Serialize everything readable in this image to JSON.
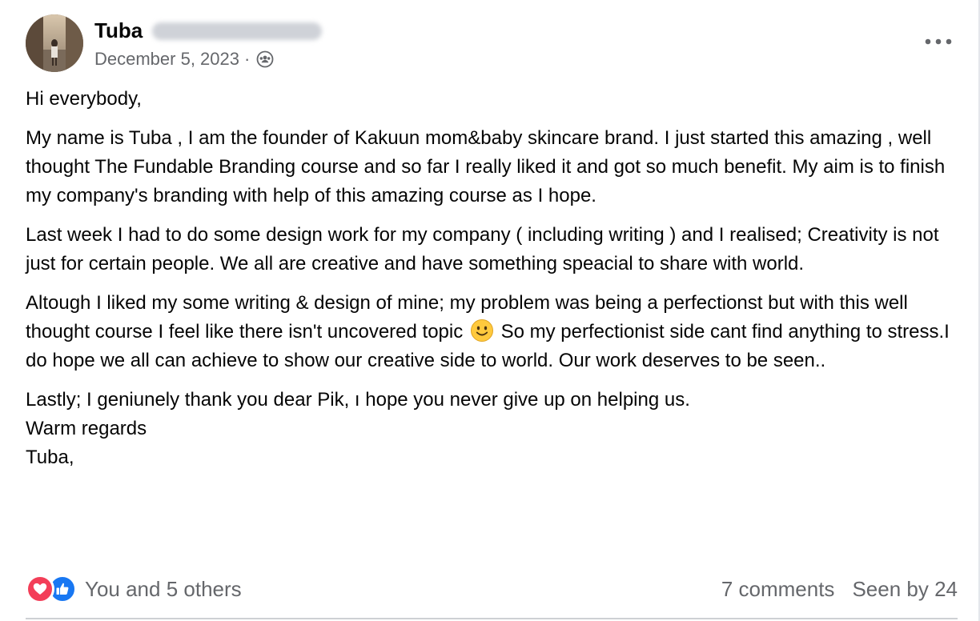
{
  "post": {
    "author_first_name": "Tuba",
    "date": "December 5, 2023",
    "separator": "·",
    "privacy_icon": "group-members-icon",
    "more_icon": "more-horizontal-icon",
    "paragraphs": [
      "Hi everybody,",
      "My name is Tuba , I am the founder of Kakuun mom&baby skincare brand. I just started this amazing , well thought The Fundable Branding course and so far I really liked it and got so much benefit. My aim is to finish my company's branding with help of this amazing course as I hope.",
      "Last week I had to do some design work for my company ( including writing ) and I realised; Creativity is not just for certain people. We all are creative and have something speacial to share with world."
    ],
    "paragraph4_before_emoji": "Altough I liked my some writing & design of mine; my problem was being a perfectionst but with this well thought course I feel like there isn't uncovered topic",
    "paragraph4_after_emoji": " So my perfectionist side cant find anything to stress.I do hope we all can achieve to show our creative side to world. Our work deserves to be seen..",
    "closing_lines": [
      "Lastly; I geniunely thank you dear Pik, ı hope you never give up on helping us.",
      "Warm regards",
      "Tuba,"
    ]
  },
  "footer": {
    "reactions_text": "You and 5 others",
    "reaction_icons": [
      "love-reaction-icon",
      "like-reaction-icon"
    ],
    "comments": "7 comments",
    "seen": "Seen by 24"
  },
  "colors": {
    "text_primary": "#050505",
    "text_secondary": "#65676b",
    "like_blue": "#1877f2",
    "love_red": "#f33e58"
  }
}
